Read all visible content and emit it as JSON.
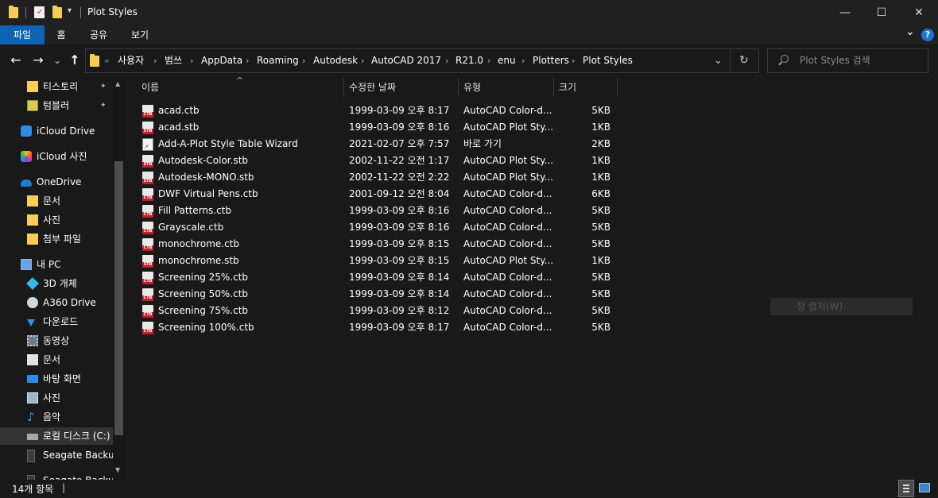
{
  "window": {
    "title": "Plot Styles",
    "minimize_glyph": "—",
    "maximize_glyph": "☐",
    "close_glyph": "✕"
  },
  "ribbon": {
    "tabs": [
      "파일",
      "홈",
      "공유",
      "보기"
    ],
    "accent": "#0f63b3",
    "expand_glyph": "⌄",
    "help_glyph": "?"
  },
  "navigation": {
    "back": "←",
    "forward": "→",
    "recent": "⌄",
    "up": "↑"
  },
  "address": {
    "overflow": "«",
    "crumbs": [
      "사용자",
      "범쓰",
      "AppData",
      "Roaming",
      "Autodesk",
      "AutoCAD 2017",
      "R21.0",
      "enu",
      "Plotters",
      "Plot Styles"
    ],
    "refresh_glyph": "↻",
    "dropdown_glyph": "⌄"
  },
  "search": {
    "placeholder": "Plot Styles 검색"
  },
  "sidebar": {
    "items": [
      {
        "label": "티스토리",
        "icon": "folder-icon"
      },
      {
        "label": "텀블러",
        "icon": "image-folder-icon"
      },
      {
        "label": "iCloud Drive",
        "icon": "icloud-icon"
      },
      {
        "label": "iCloud 사진",
        "icon": "icloud-photos-icon"
      },
      {
        "label": "OneDrive",
        "icon": "onedrive-icon"
      },
      {
        "label": "문서",
        "icon": "folder-icon"
      },
      {
        "label": "사진",
        "icon": "folder-icon"
      },
      {
        "label": "첨부 파일",
        "icon": "folder-icon"
      },
      {
        "label": "내 PC",
        "icon": "pc-icon"
      },
      {
        "label": "3D 개체",
        "icon": "3d-objects-icon"
      },
      {
        "label": "A360 Drive",
        "icon": "a360-drive-icon"
      },
      {
        "label": "다운로드",
        "icon": "download-icon"
      },
      {
        "label": "동영상",
        "icon": "video-icon"
      },
      {
        "label": "문서",
        "icon": "documents-icon"
      },
      {
        "label": "바탕 화면",
        "icon": "desktop-icon"
      },
      {
        "label": "사진",
        "icon": "pictures-icon"
      },
      {
        "label": "음악",
        "icon": "music-icon"
      },
      {
        "label": "로컬 디스크 (C:)",
        "icon": "local-disk-icon"
      },
      {
        "label": "Seagate Backup",
        "icon": "external-drive-icon"
      },
      {
        "label": "Seagate Backup F",
        "icon": "external-drive-icon"
      }
    ],
    "pin_glyph": "📌"
  },
  "columns": {
    "name": "이름",
    "modified": "수정한 날짜",
    "type": "유형",
    "size": "크기",
    "sort_glyph": "^"
  },
  "files": [
    {
      "name": "acad.ctb",
      "modified": "1999-03-09 오후 8:17",
      "type": "AutoCAD Color-d...",
      "size": "5KB",
      "badge": "CTB"
    },
    {
      "name": "acad.stb",
      "modified": "1999-03-09 오후 8:16",
      "type": "AutoCAD Plot Sty...",
      "size": "1KB",
      "badge": "STB"
    },
    {
      "name": "Add-A-Plot Style Table Wizard",
      "modified": "2021-02-07 오후 7:57",
      "type": "바로 가기",
      "size": "2KB",
      "badge": ""
    },
    {
      "name": "Autodesk-Color.stb",
      "modified": "2002-11-22 오전 1:17",
      "type": "AutoCAD Plot Sty...",
      "size": "1KB",
      "badge": "STB"
    },
    {
      "name": "Autodesk-MONO.stb",
      "modified": "2002-11-22 오전 2:22",
      "type": "AutoCAD Plot Sty...",
      "size": "1KB",
      "badge": "STB"
    },
    {
      "name": "DWF Virtual Pens.ctb",
      "modified": "2001-09-12 오전 8:04",
      "type": "AutoCAD Color-d...",
      "size": "6KB",
      "badge": "CTB"
    },
    {
      "name": "Fill Patterns.ctb",
      "modified": "1999-03-09 오후 8:16",
      "type": "AutoCAD Color-d...",
      "size": "5KB",
      "badge": "CTB"
    },
    {
      "name": "Grayscale.ctb",
      "modified": "1999-03-09 오후 8:16",
      "type": "AutoCAD Color-d...",
      "size": "5KB",
      "badge": "CTB"
    },
    {
      "name": "monochrome.ctb",
      "modified": "1999-03-09 오후 8:15",
      "type": "AutoCAD Color-d...",
      "size": "5KB",
      "badge": "CTB"
    },
    {
      "name": "monochrome.stb",
      "modified": "1999-03-09 오후 8:15",
      "type": "AutoCAD Plot Sty...",
      "size": "1KB",
      "badge": "STB"
    },
    {
      "name": "Screening 25%.ctb",
      "modified": "1999-03-09 오후 8:14",
      "type": "AutoCAD Color-d...",
      "size": "5KB",
      "badge": "CTB"
    },
    {
      "name": "Screening 50%.ctb",
      "modified": "1999-03-09 오후 8:14",
      "type": "AutoCAD Color-d...",
      "size": "5KB",
      "badge": "CTB"
    },
    {
      "name": "Screening 75%.ctb",
      "modified": "1999-03-09 오후 8:12",
      "type": "AutoCAD Color-d...",
      "size": "5KB",
      "badge": "CTB"
    },
    {
      "name": "Screening 100%.ctb",
      "modified": "1999-03-09 오후 8:17",
      "type": "AutoCAD Color-d...",
      "size": "5KB",
      "badge": "CTB"
    }
  ],
  "tooltip": "창 캡처(W)",
  "status": {
    "item_count": "14개 항목"
  }
}
